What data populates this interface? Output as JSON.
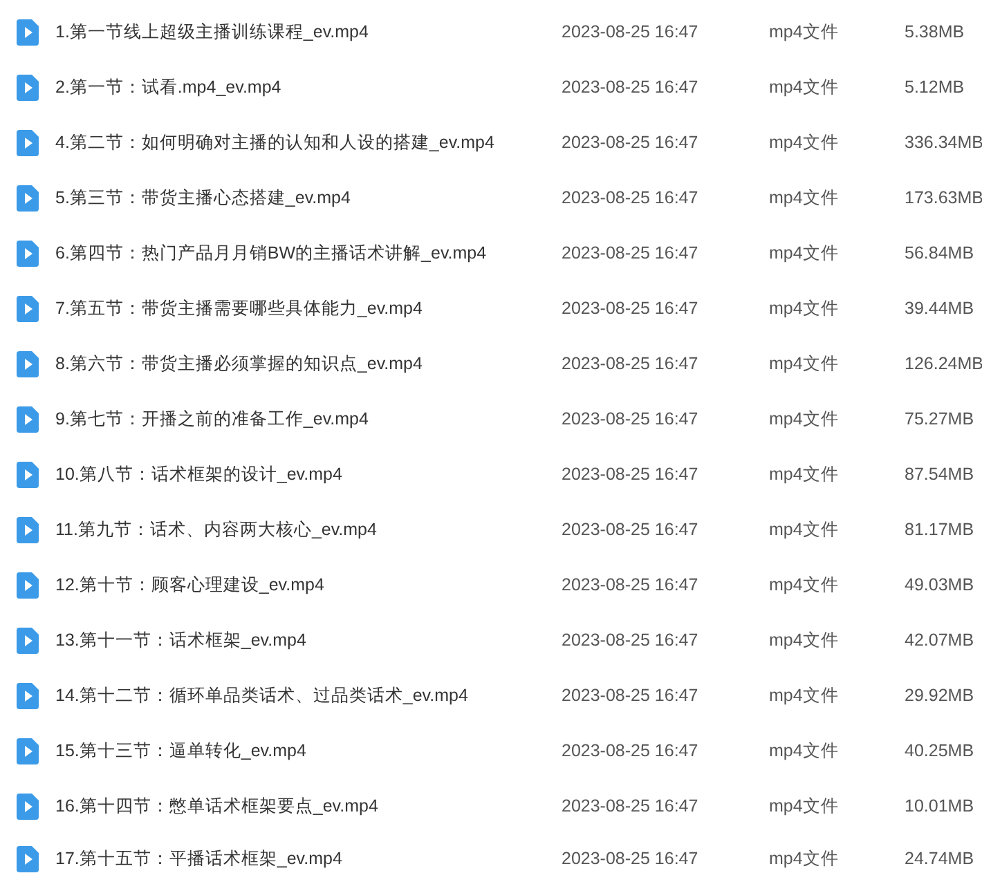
{
  "files": [
    {
      "name": "1.第一节线上超级主播训练课程_ev.mp4",
      "modified": "2023-08-25 16:47",
      "type": "mp4文件",
      "size": "5.38MB"
    },
    {
      "name": "2.第一节：试看.mp4_ev.mp4",
      "modified": "2023-08-25 16:47",
      "type": "mp4文件",
      "size": "5.12MB"
    },
    {
      "name": "4.第二节：如何明确对主播的认知和人设的搭建_ev.mp4",
      "modified": "2023-08-25 16:47",
      "type": "mp4文件",
      "size": "336.34MB"
    },
    {
      "name": "5.第三节：带货主播心态搭建_ev.mp4",
      "modified": "2023-08-25 16:47",
      "type": "mp4文件",
      "size": "173.63MB"
    },
    {
      "name": "6.第四节：热门产品月月销BW的主播话术讲解_ev.mp4",
      "modified": "2023-08-25 16:47",
      "type": "mp4文件",
      "size": "56.84MB"
    },
    {
      "name": "7.第五节：带货主播需要哪些具体能力_ev.mp4",
      "modified": "2023-08-25 16:47",
      "type": "mp4文件",
      "size": "39.44MB"
    },
    {
      "name": "8.第六节：带货主播必须掌握的知识点_ev.mp4",
      "modified": "2023-08-25 16:47",
      "type": "mp4文件",
      "size": "126.24MB"
    },
    {
      "name": "9.第七节：开播之前的准备工作_ev.mp4",
      "modified": "2023-08-25 16:47",
      "type": "mp4文件",
      "size": "75.27MB"
    },
    {
      "name": "10.第八节：话术框架的设计_ev.mp4",
      "modified": "2023-08-25 16:47",
      "type": "mp4文件",
      "size": "87.54MB"
    },
    {
      "name": "11.第九节：话术、内容两大核心_ev.mp4",
      "modified": "2023-08-25 16:47",
      "type": "mp4文件",
      "size": "81.17MB"
    },
    {
      "name": "12.第十节：顾客心理建设_ev.mp4",
      "modified": "2023-08-25 16:47",
      "type": "mp4文件",
      "size": "49.03MB"
    },
    {
      "name": "13.第十一节：话术框架_ev.mp4",
      "modified": "2023-08-25 16:47",
      "type": "mp4文件",
      "size": "42.07MB"
    },
    {
      "name": "14.第十二节：循环单品类话术、过品类话术_ev.mp4",
      "modified": "2023-08-25 16:47",
      "type": "mp4文件",
      "size": "29.92MB"
    },
    {
      "name": "15.第十三节：逼单转化_ev.mp4",
      "modified": "2023-08-25 16:47",
      "type": "mp4文件",
      "size": "40.25MB"
    },
    {
      "name": "16.第十四节：憋单话术框架要点_ev.mp4",
      "modified": "2023-08-25 16:47",
      "type": "mp4文件",
      "size": "10.01MB"
    },
    {
      "name": "17.第十五节：平播话术框架_ev.mp4",
      "modified": "2023-08-25 16:47",
      "type": "mp4文件",
      "size": "24.74MB"
    }
  ]
}
